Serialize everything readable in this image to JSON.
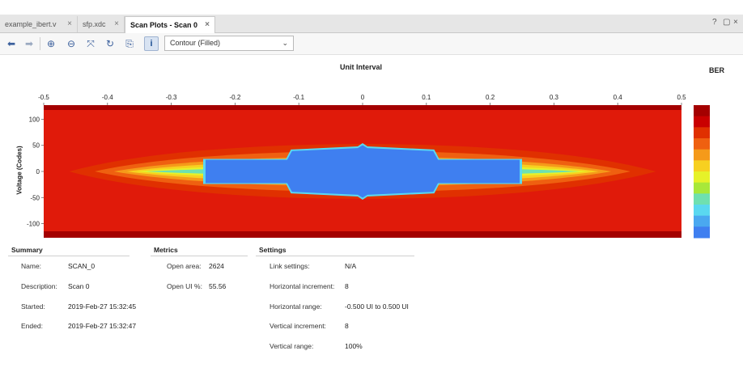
{
  "tabs": [
    {
      "label": "example_ibert.v",
      "close": "×"
    },
    {
      "label": "sfp.xdc",
      "close": "×"
    },
    {
      "label": "Scan Plots - Scan 0",
      "close": "×"
    }
  ],
  "window_controls": {
    "help": "?",
    "restore": "▢",
    "close": "×"
  },
  "toolbar": {
    "icons": [
      "back-arrow-icon",
      "forward-arrow-icon",
      "zoom-in-icon",
      "zoom-out-icon",
      "fit-icon",
      "refresh-icon",
      "export-icon",
      "info-icon"
    ],
    "plot_type_selected": "Contour (Filled)"
  },
  "chart_data": {
    "type": "heatmap",
    "title": "Unit Interval",
    "xlabel": "Unit Interval",
    "ylabel": "Voltage (Codes)",
    "xlim": [
      -0.5,
      0.5
    ],
    "ylim": [
      -127,
      127
    ],
    "x_ticks": [
      "-0.5",
      "-0.4",
      "-0.3",
      "-0.2",
      "-0.1",
      "0",
      "0.1",
      "0.2",
      "0.3",
      "0.4",
      "0.5"
    ],
    "y_ticks": [
      "100",
      "50",
      "0",
      "-50",
      "-100"
    ],
    "colorbar_label": "BER",
    "colorbar_colors": [
      "#a40000",
      "#c90000",
      "#e03000",
      "#ef6010",
      "#f59a1a",
      "#f7d020",
      "#e6f229",
      "#a8e83a",
      "#6fe0b0",
      "#5ad8f0",
      "#4aa8f0",
      "#3f7ff0"
    ],
    "open_region": {
      "ui_halfwidth": 0.25,
      "code_halfheight": 24,
      "center_peak_codes": 48
    },
    "colors": {
      "outer": "#e01a0a",
      "open": "#3f7ff0"
    }
  },
  "summary": {
    "header": "Summary",
    "rows": [
      {
        "label": "Name:",
        "value": "SCAN_0"
      },
      {
        "label": "Description:",
        "value": "Scan 0"
      },
      {
        "label": "Started:",
        "value": "2019-Feb-27 15:32:45"
      },
      {
        "label": "Ended:",
        "value": "2019-Feb-27 15:32:47"
      }
    ]
  },
  "metrics": {
    "header": "Metrics",
    "rows": [
      {
        "label": "Open area:",
        "value": "2624"
      },
      {
        "label": "Open UI %:",
        "value": "55.56"
      }
    ]
  },
  "settings": {
    "header": "Settings",
    "rows": [
      {
        "label": "Link settings:",
        "value": "N/A"
      },
      {
        "label": "Horizontal increment:",
        "value": "8"
      },
      {
        "label": "Horizontal range:",
        "value": "-0.500 UI to 0.500 UI"
      },
      {
        "label": "Vertical increment:",
        "value": "8"
      },
      {
        "label": "Vertical range:",
        "value": "100%"
      }
    ]
  }
}
